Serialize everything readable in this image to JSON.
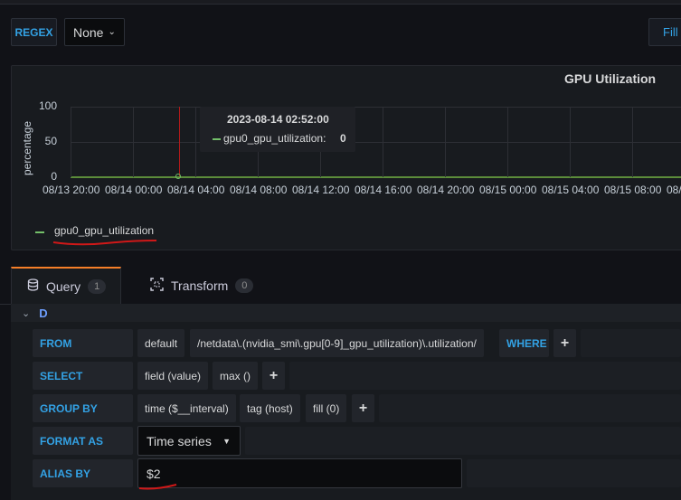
{
  "toolbar": {
    "regex_label": "REGEX",
    "select_value": "None",
    "fill_label": "Fill"
  },
  "panel": {
    "title": "GPU Utilization",
    "tooltip": {
      "time": "2023-08-14 02:52:00",
      "series": "gpu0_gpu_utilization:",
      "value": "0"
    },
    "legend": "gpu0_gpu_utilization",
    "colors": {
      "series": "#73bf69",
      "cursor": "#b11a1a"
    }
  },
  "chart_data": {
    "type": "line",
    "ylabel": "percentage",
    "ylim": [
      0,
      100
    ],
    "yticks": [
      "100",
      "50",
      "0"
    ],
    "xticks": [
      "08/13 20:00",
      "08/14 00:00",
      "08/14 04:00",
      "08/14 08:00",
      "08/14 12:00",
      "08/14 16:00",
      "08/14 20:00",
      "08/15 00:00",
      "08/15 04:00",
      "08/15 08:00",
      "08/"
    ],
    "series": [
      {
        "name": "gpu0_gpu_utilization",
        "values": [
          0,
          0,
          0,
          0,
          0,
          0,
          0,
          0,
          0,
          0,
          0
        ]
      }
    ],
    "grid": true,
    "legend": "bottom-left"
  },
  "tabs": {
    "query": {
      "label": "Query",
      "count": "1"
    },
    "transform": {
      "label": "Transform",
      "count": "0"
    }
  },
  "editor": {
    "ref_id": "D",
    "from": {
      "keyword": "FROM",
      "policy": "default",
      "measurement": "/netdata\\.(nvidia_smi\\.gpu[0-9]_gpu_utilization)\\.utilization/",
      "where": "WHERE",
      "plus": "+"
    },
    "select": {
      "keyword": "SELECT",
      "field": "field (value)",
      "agg": "max ()",
      "plus": "+"
    },
    "group_by": {
      "keyword": "GROUP BY",
      "time": "time ($__interval)",
      "tag": "tag (host)",
      "fill": "fill (0)",
      "plus": "+"
    },
    "format_as": {
      "keyword": "FORMAT AS",
      "value": "Time series"
    },
    "alias_by": {
      "keyword": "ALIAS BY",
      "value": "$2"
    }
  }
}
